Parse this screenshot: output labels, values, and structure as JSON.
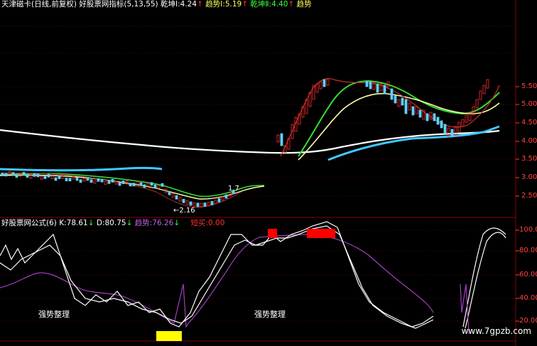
{
  "header": {
    "title": "天津磁卡(日线,前复权)",
    "indicator": "好股票网指标(5,13,55)",
    "q1_label": "乾坤Ⅰ:",
    "q1_value": "4.24",
    "q1_arrow": "↑",
    "t1_label": "趋势Ⅰ:",
    "t1_value": "5.19",
    "t1_arrow": "↑",
    "q2_label": "乾坤Ⅱ:",
    "q2_value": "4.40",
    "q2_arrow": "↑",
    "t2_label": "趋势"
  },
  "sub_header": {
    "formula": "好股票网公式(6)",
    "k_label": "K:",
    "k_value": "78.61",
    "k_arrow": "↓",
    "d_label": "D:",
    "d_value": "80.75",
    "d_arrow": "↓",
    "trend_label": "趋势:",
    "trend_value": "76.26",
    "trend_arrow": "↓",
    "short_label": "短买:",
    "short_value": "0.00"
  },
  "main_axis": [
    "5.50",
    "5.00",
    "4.50",
    "4.00",
    "3.50",
    "3.00",
    "2.50"
  ],
  "sub_axis": [
    "100.0",
    "80.00",
    "60.00",
    "40.00",
    "20.00"
  ],
  "annotations": {
    "low": "←2.16",
    "high": "1.7"
  },
  "section_labels": [
    "强势整理",
    "强势整理"
  ],
  "watermark": "www.7gpzb.com",
  "colors": {
    "bg": "#000000",
    "grid": "#8b0000",
    "axis_text": "#ff4040",
    "white_line": "#ffffff",
    "cyan_line": "#40c8ff",
    "green_line": "#33dd33",
    "yellow_line": "#ffffaa",
    "purple_line": "#a040c0",
    "red_block": "#ff0000",
    "yellow_block": "#ffff00"
  }
}
